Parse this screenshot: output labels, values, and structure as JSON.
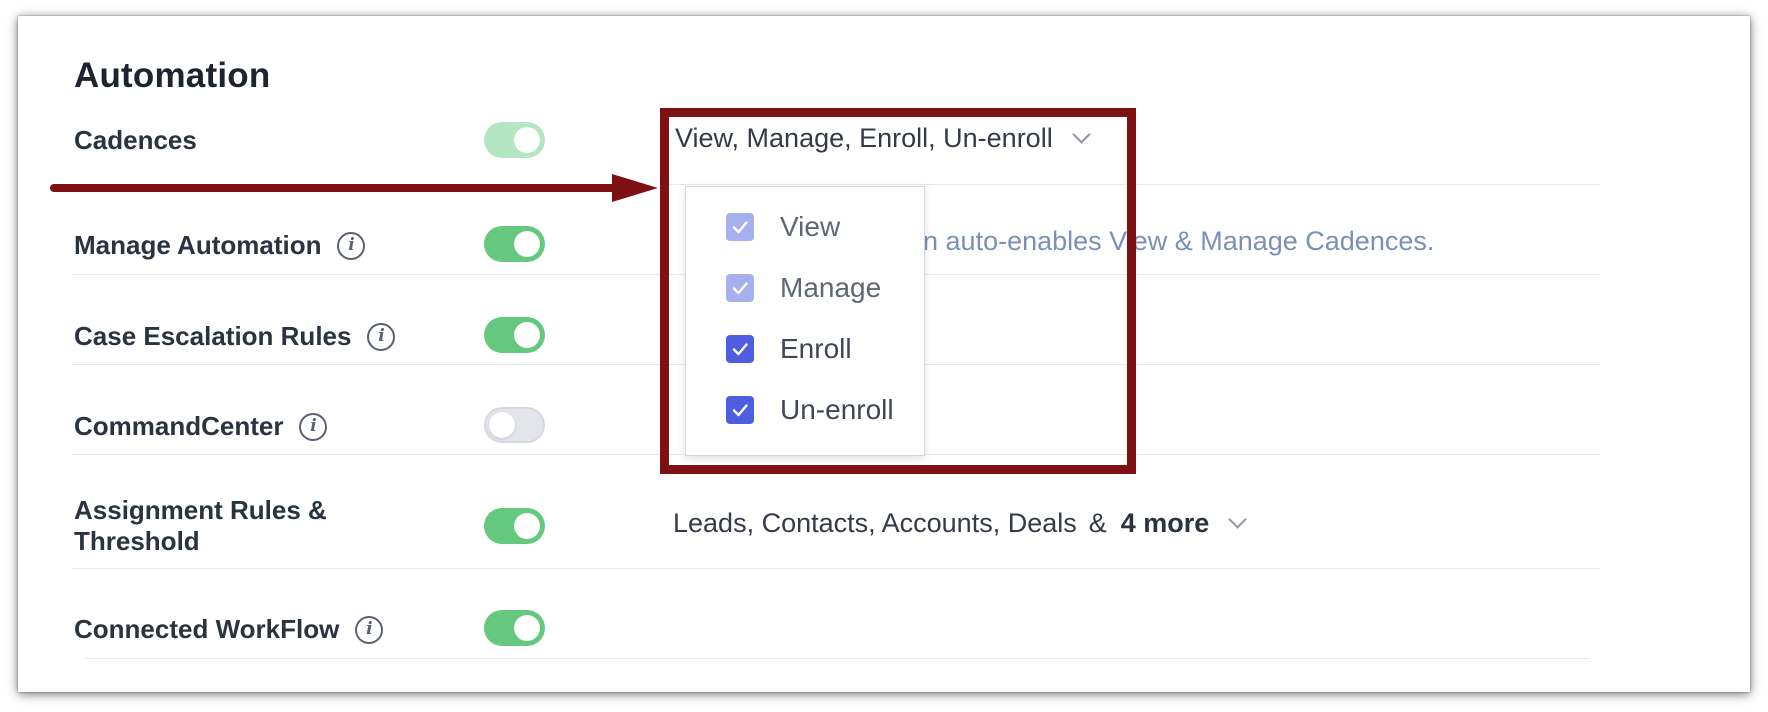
{
  "section_title": "Automation",
  "rows": [
    {
      "label": "Cadences",
      "info": false,
      "toggle": "faded"
    },
    {
      "label": "Manage Automation",
      "info": true,
      "toggle": "on"
    },
    {
      "label": "Case Escalation Rules",
      "info": true,
      "toggle": "on"
    },
    {
      "label": "CommandCenter",
      "info": true,
      "toggle": "off"
    },
    {
      "label": "Assignment Rules & Threshold",
      "label_line1": "Assignment Rules &",
      "label_line2": "Threshold",
      "info": false,
      "toggle": "on"
    },
    {
      "label": "Connected WorkFlow",
      "info": true,
      "toggle": "on"
    }
  ],
  "cadences_select": {
    "value": "View, Manage, Enroll, Un-enroll",
    "options": [
      {
        "label": "View",
        "checked": true,
        "disabled": true
      },
      {
        "label": "Manage",
        "checked": true,
        "disabled": true
      },
      {
        "label": "Enroll",
        "checked": true,
        "disabled": false
      },
      {
        "label": "Un-enroll",
        "checked": true,
        "disabled": false
      }
    ]
  },
  "manage_automation_hint": "on auto-enables View & Manage Cadences.",
  "assignment_select": {
    "value": "Leads, Contacts, Accounts, Deals",
    "amp": "&",
    "more": "4 more"
  },
  "colors": {
    "toggle_on": "#64c87e",
    "toggle_faded": "#b4e6c1",
    "toggle_off": "#e3e4ea",
    "checkbox": "#4d5ee0",
    "checkbox_disabled": "#a7b0ee",
    "annotation": "#7e1114",
    "hint": "#7a90b8"
  },
  "icons": {
    "info": "info-circle-icon",
    "dropdown": "chevron-down-icon",
    "check": "checkmark-icon",
    "annotation_arrow": "arrow-right-icon"
  }
}
